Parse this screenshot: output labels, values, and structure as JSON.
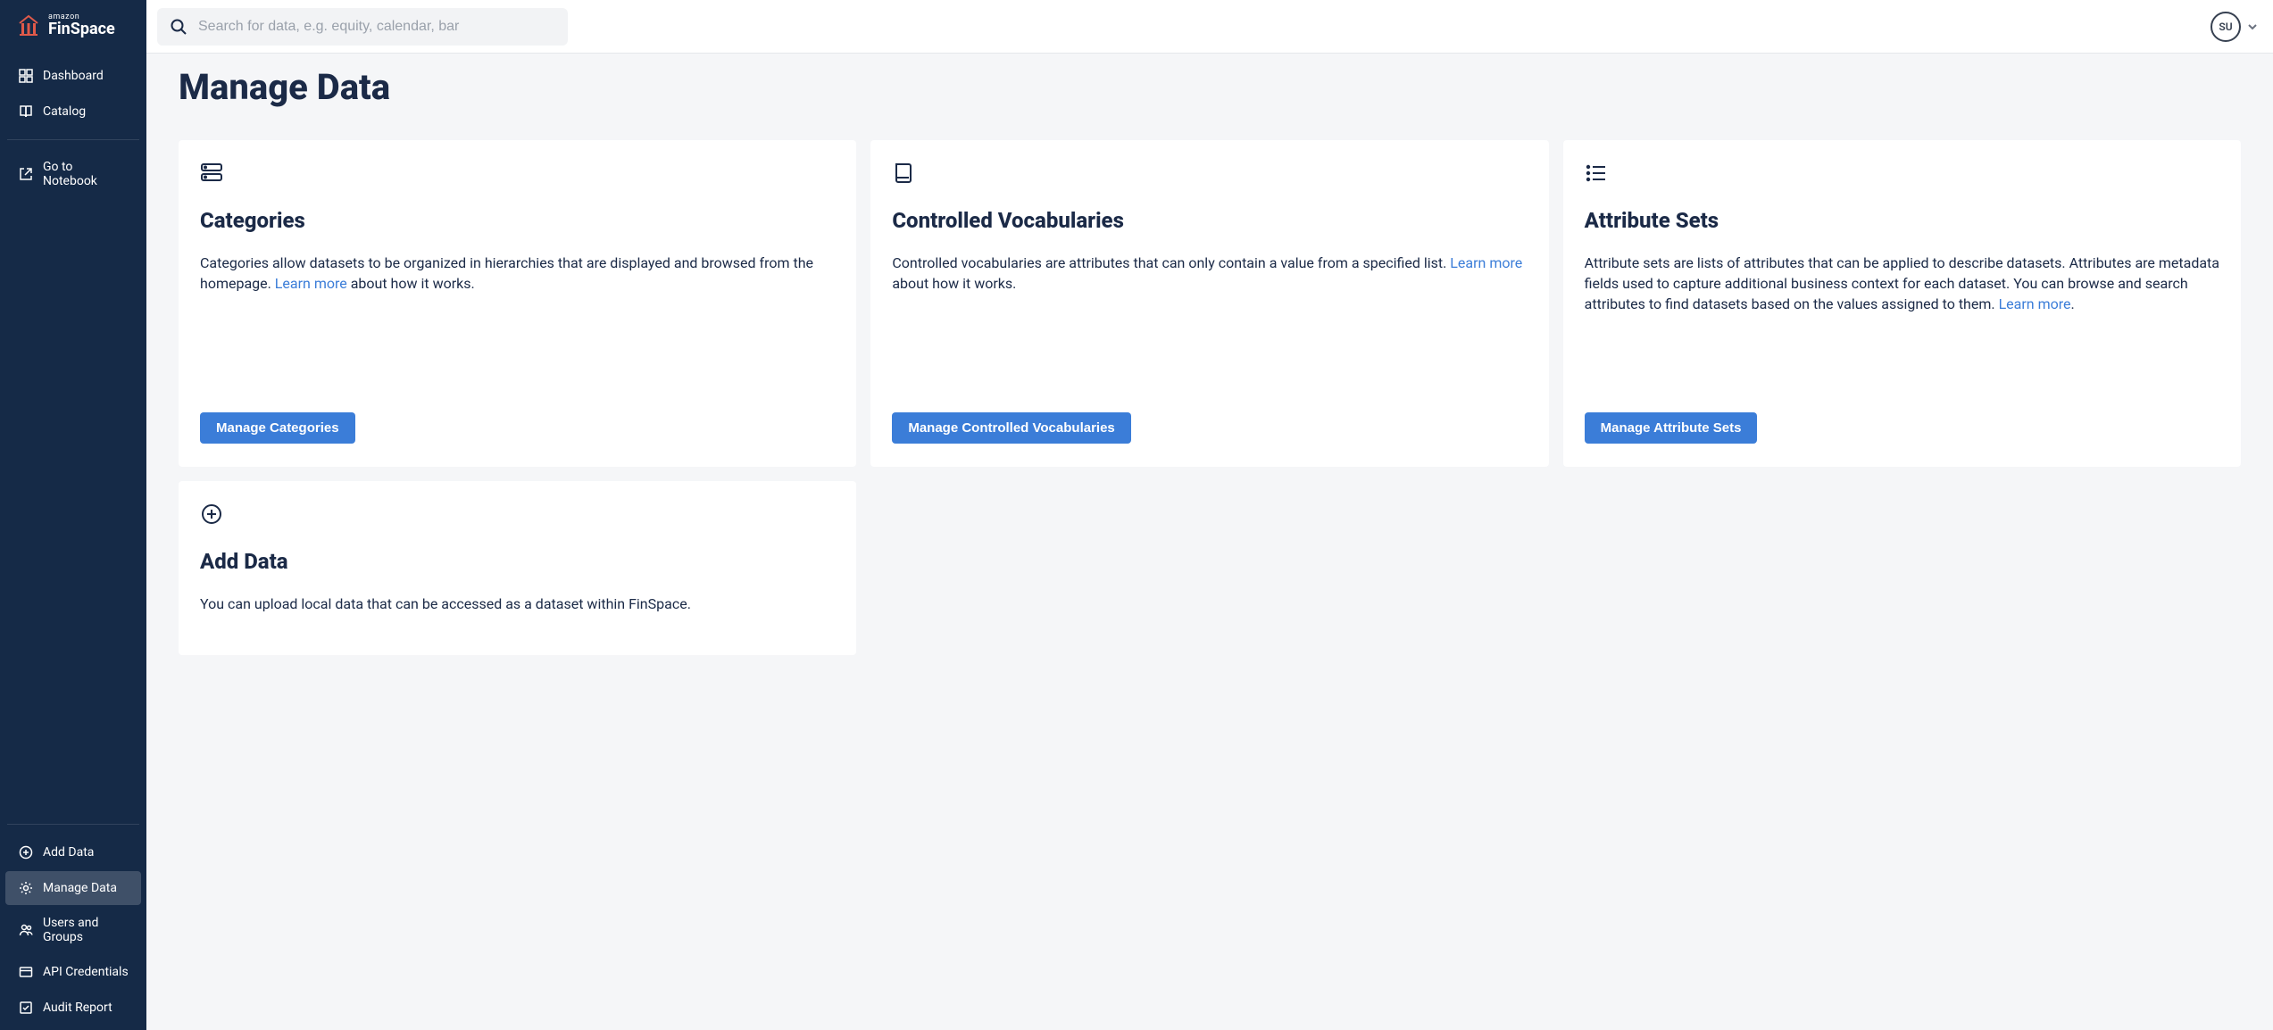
{
  "logo": {
    "amazon": "amazon",
    "product": "FinSpace"
  },
  "sidebar": {
    "top_items": [
      {
        "label": "Dashboard"
      },
      {
        "label": "Catalog"
      }
    ],
    "notebook_label": "Go to Notebook",
    "bottom_items": [
      {
        "label": "Add Data"
      },
      {
        "label": "Manage Data"
      },
      {
        "label": "Users and Groups"
      },
      {
        "label": "API Credentials"
      },
      {
        "label": "Audit Report"
      }
    ]
  },
  "search": {
    "placeholder": "Search for data, e.g. equity, calendar, bar"
  },
  "user": {
    "initials": "SU"
  },
  "page": {
    "title": "Manage Data"
  },
  "cards": {
    "categories": {
      "title": "Categories",
      "desc_pre": "Categories allow datasets to be organized in hierarchies that are displayed and browsed from the homepage. ",
      "learn": "Learn more",
      "desc_post": " about how it works.",
      "button": "Manage Categories"
    },
    "vocab": {
      "title": "Controlled Vocabularies",
      "desc_pre": "Controlled vocabularies are attributes that can only contain a value from a specified list. ",
      "learn": "Learn more",
      "desc_post": " about how it works.",
      "button": "Manage Controlled Vocabularies"
    },
    "attrsets": {
      "title": "Attribute Sets",
      "desc_pre": "Attribute sets are lists of attributes that can be applied to describe datasets. Attributes are metadata fields used to capture additional business context for each dataset. You can browse and search attributes to find datasets based on the values assigned to them. ",
      "learn": "Learn more",
      "desc_post": ".",
      "button": "Manage Attribute Sets"
    },
    "adddata": {
      "title": "Add Data",
      "desc": "You can upload local data that can be accessed as a dataset within FinSpace."
    }
  }
}
